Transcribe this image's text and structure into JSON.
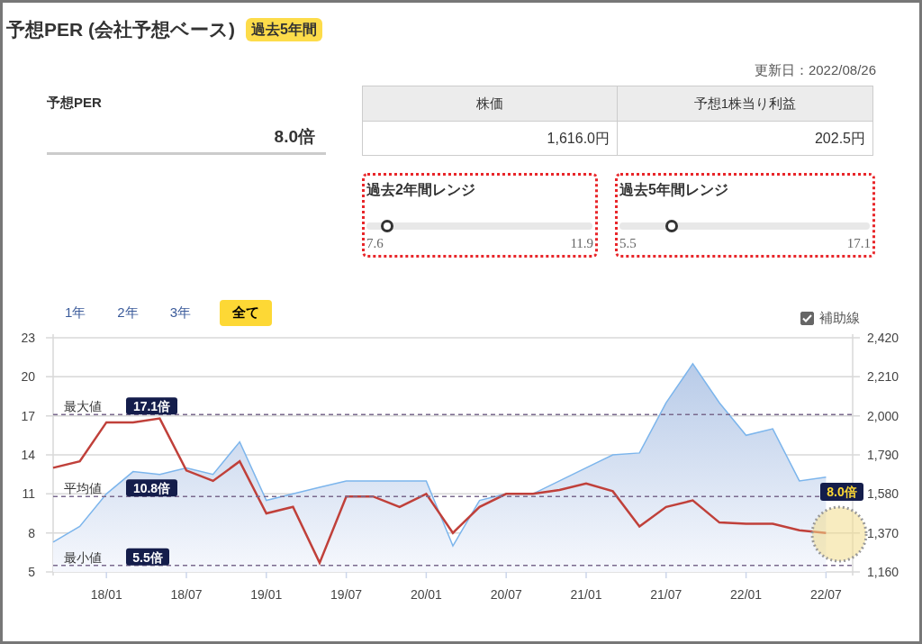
{
  "header": {
    "title": "予想PER (会社予想ベース)",
    "badge": "過去5年間",
    "updated": "更新日：2022/08/26"
  },
  "per": {
    "label": "予想PER",
    "value": "8.0倍"
  },
  "price_table": {
    "columns": [
      "株価",
      "予想1株当り利益"
    ],
    "values": [
      "1,616.0円",
      "202.5円"
    ]
  },
  "ranges": [
    {
      "title": "過去2年間レンジ",
      "level": 0.09,
      "min": "7.6",
      "max": "11.9"
    },
    {
      "title": "過去5年間レンジ",
      "level": 0.21,
      "min": "5.5",
      "max": "17.1"
    }
  ],
  "period_tabs": [
    {
      "label": "1年",
      "selected": false
    },
    {
      "label": "2年",
      "selected": false
    },
    {
      "label": "3年",
      "selected": false
    },
    {
      "label": "全て",
      "selected": true
    }
  ],
  "guide_lines": {
    "label": "補助線",
    "checked": true
  },
  "chart": {
    "current_label": "8.0倍",
    "chart_data": {
      "type": "line",
      "categories": [
        null,
        null,
        "18/01",
        null,
        null,
        "18/07",
        null,
        null,
        "19/01",
        null,
        null,
        "19/07",
        null,
        null,
        "20/01",
        null,
        null,
        "20/07",
        null,
        null,
        "21/01",
        null,
        null,
        "21/07",
        null,
        null,
        "22/01",
        null,
        null,
        "22/07"
      ],
      "series": [
        {
          "color": "#c0403a",
          "values": [
            13,
            13.5,
            16.5,
            16.5,
            16.8,
            12.8,
            12,
            13.5,
            9.5,
            10,
            5.7,
            10.8,
            10.8,
            10,
            11,
            8,
            10,
            11,
            11,
            11.3,
            11.8,
            11.2,
            8.5,
            10,
            10.5,
            8.8,
            8.7,
            8.7,
            8.2,
            8.0
          ]
        },
        {
          "color": "#7cb5ec",
          "axis": "y2",
          "type": "area",
          "values": [
            1321,
            1405,
            1580,
            1700,
            1685,
            1720,
            1685,
            1860,
            1545,
            1580,
            1615,
            1650,
            1650,
            1650,
            1650,
            1300,
            1545,
            1580,
            1580,
            1650,
            1720,
            1790,
            1800,
            2070,
            2280,
            2070,
            1895,
            1930,
            1650,
            1670
          ]
        }
      ],
      "ylim": [
        5,
        23
      ],
      "yticks": [
        5,
        8,
        11,
        14,
        17,
        20,
        23
      ],
      "y2lim": [
        1160,
        2420
      ],
      "y2ticks": [
        {
          "value": 1160,
          "label": "1,160"
        },
        {
          "value": 1370,
          "label": "1,370"
        },
        {
          "value": 1580,
          "label": "1,580"
        },
        {
          "value": 1790,
          "label": "1,790"
        },
        {
          "value": 2000,
          "label": "2,000"
        },
        {
          "value": 2210,
          "label": "2,210"
        },
        {
          "value": 2420,
          "label": "2,420"
        }
      ],
      "grid": true,
      "ref_lines": [
        {
          "axis": "y",
          "value": 17.1,
          "label": "17.1倍"
        },
        {
          "axis": "y",
          "value": 10.8,
          "label": "10.8倍"
        },
        {
          "axis": "y",
          "value": 5.5,
          "label": "5.5倍"
        }
      ],
      "annotations": [
        "最大値",
        "平均値",
        "最小値"
      ]
    }
  }
}
